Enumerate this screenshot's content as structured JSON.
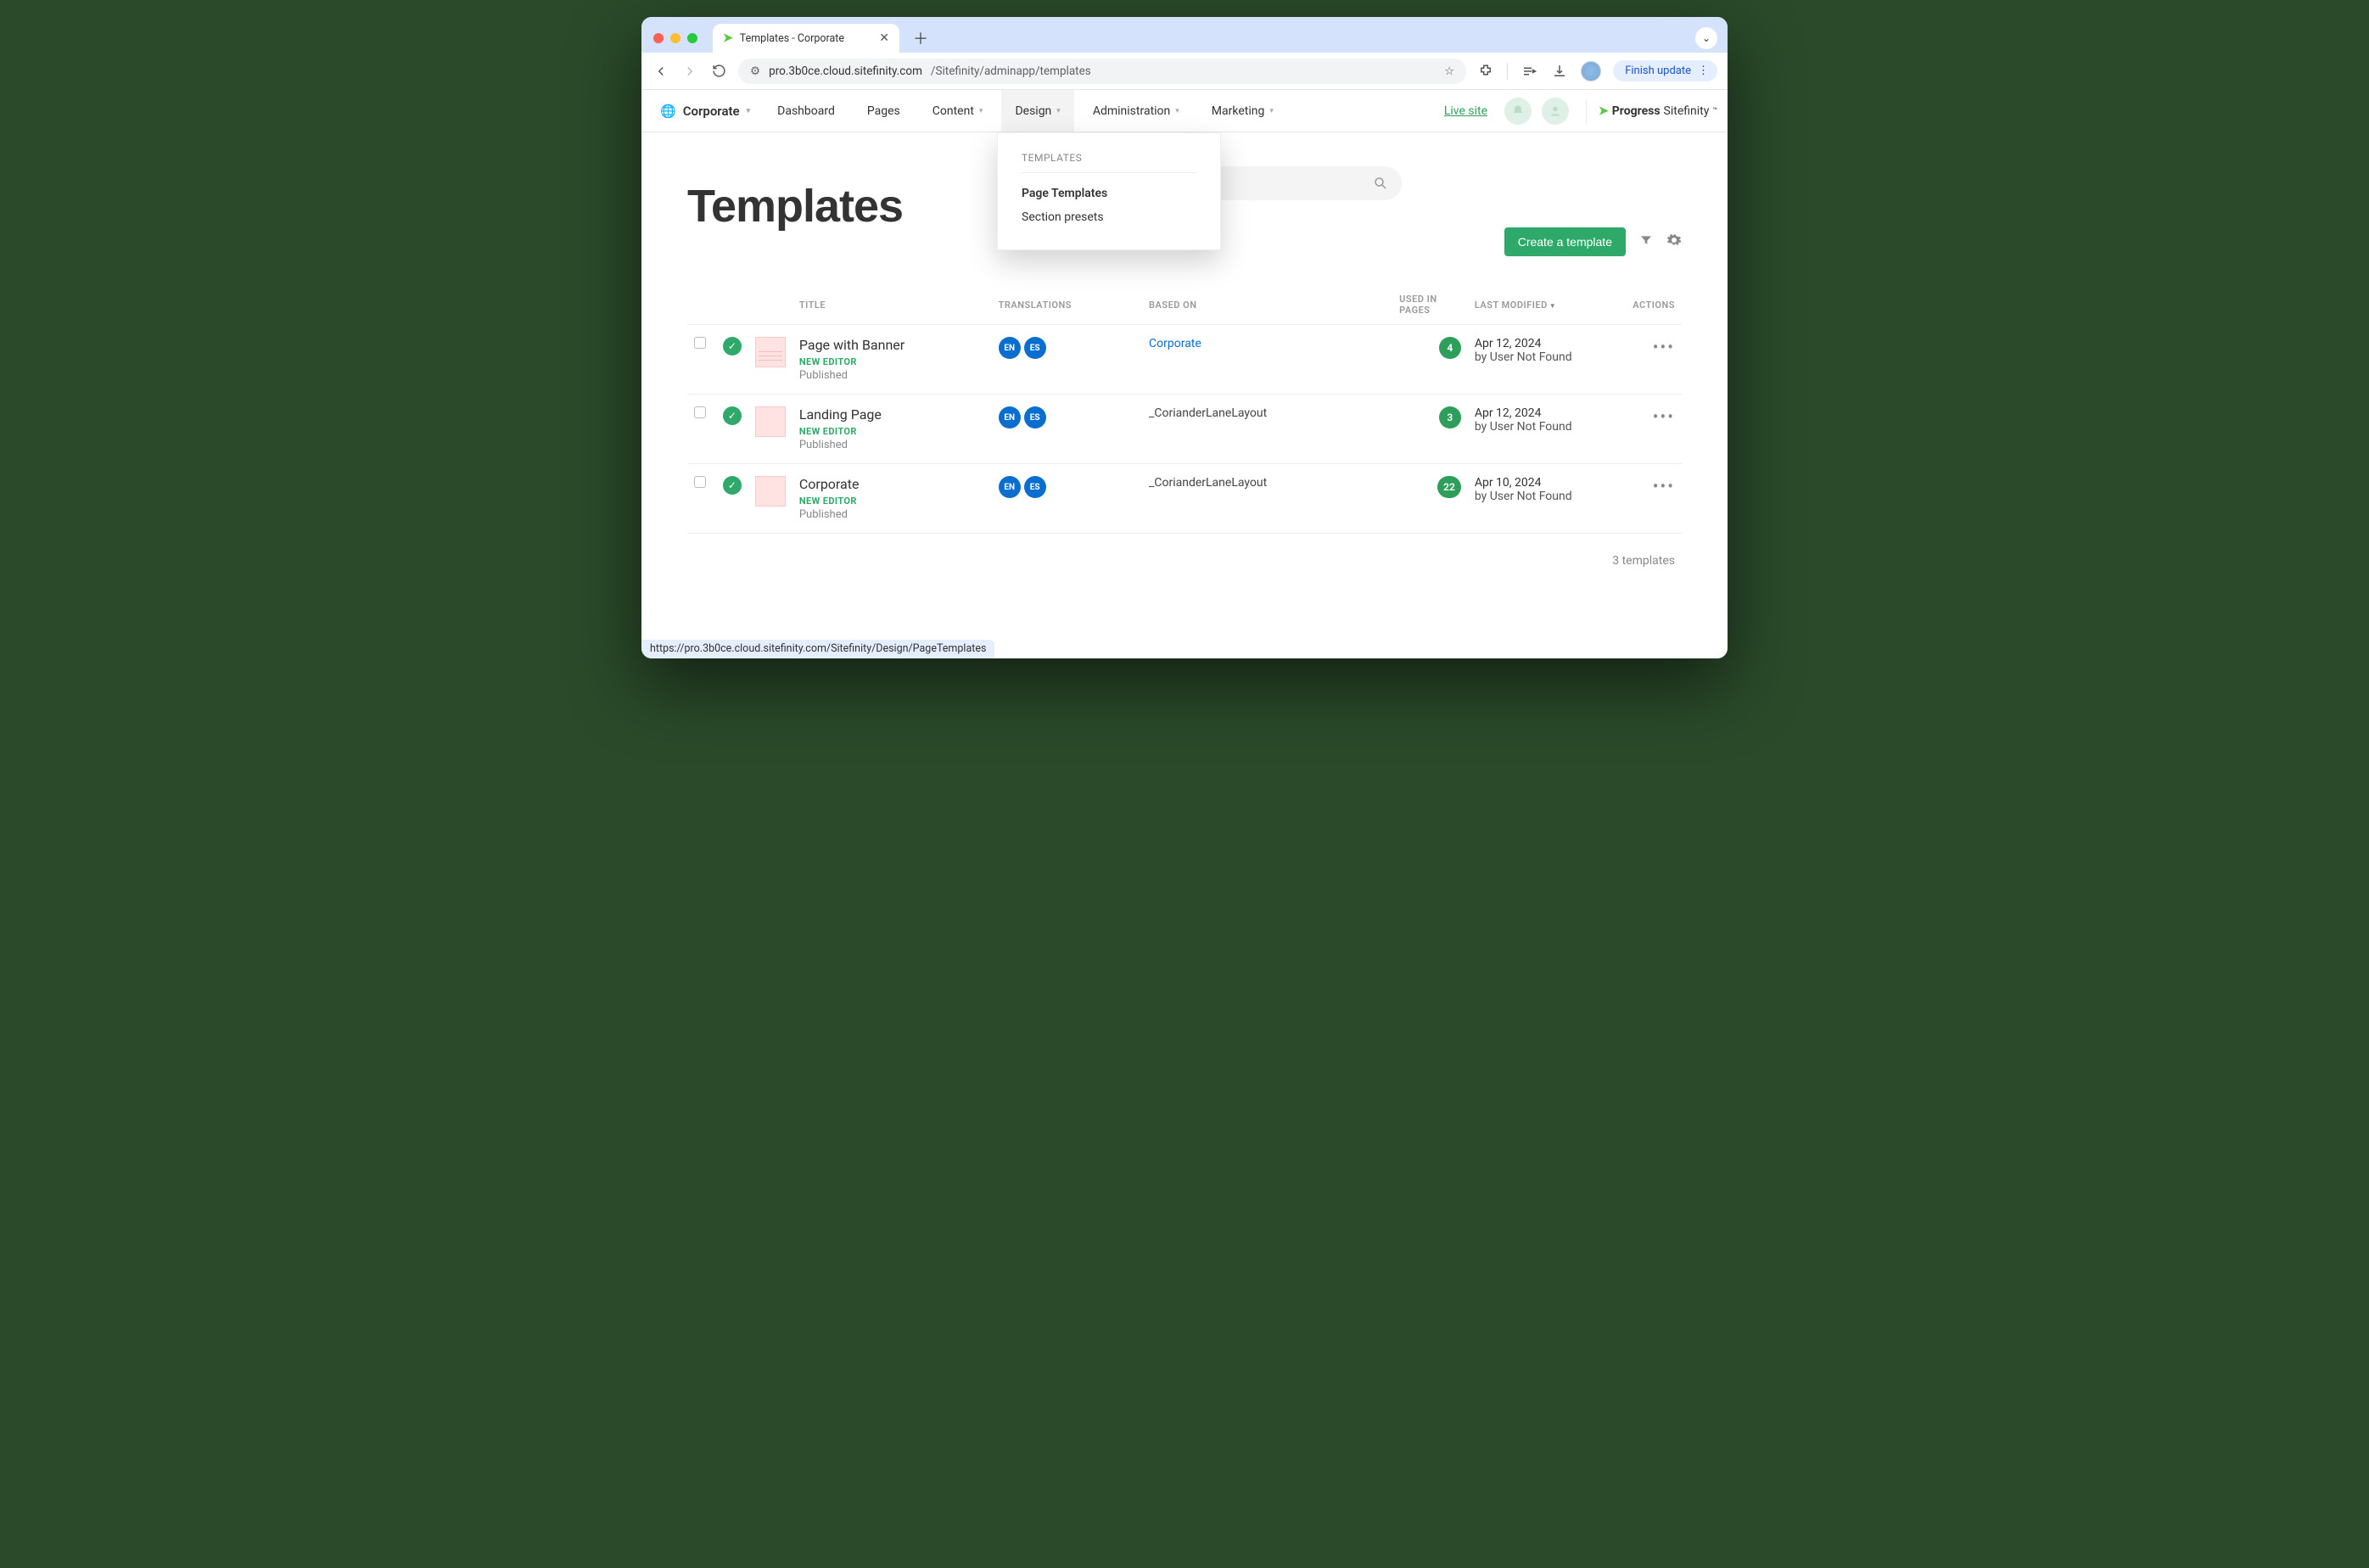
{
  "browser": {
    "tab_title": "Templates - Corporate",
    "url_host": "pro.3b0ce.cloud.sitefinity.com",
    "url_path": "/Sitefinity/adminapp/templates",
    "finish_update": "Finish update"
  },
  "topnav": {
    "site_name": "Corporate",
    "items": {
      "dashboard": "Dashboard",
      "pages": "Pages",
      "content": "Content",
      "design": "Design",
      "administration": "Administration",
      "marketing": "Marketing"
    },
    "live_site": "Live site",
    "brand_a": "Progress",
    "brand_b": "Sitefinity"
  },
  "design_menu": {
    "group": "TEMPLATES",
    "page_templates": "Page Templates",
    "section_presets": "Section presets"
  },
  "page": {
    "title": "Templates",
    "create_btn": "Create a template",
    "columns": {
      "title": "TITLE",
      "translations": "TRANSLATIONS",
      "based_on": "BASED ON",
      "used_in_pages": "USED IN PAGES",
      "last_modified": "LAST MODIFIED",
      "actions": "ACTIONS"
    },
    "footer": "3 templates"
  },
  "rows": [
    {
      "title": "Page with Banner",
      "tag": "NEW EDITOR",
      "status": "Published",
      "langs": [
        "EN",
        "ES"
      ],
      "based_on": "Corporate",
      "based_on_link": true,
      "count": "4",
      "date": "Apr 12, 2024",
      "by": "by User Not Found",
      "thumb_lines": true
    },
    {
      "title": "Landing Page",
      "tag": "NEW EDITOR",
      "status": "Published",
      "langs": [
        "EN",
        "ES"
      ],
      "based_on": "_CorianderLaneLayout",
      "based_on_link": false,
      "count": "3",
      "date": "Apr 12, 2024",
      "by": "by User Not Found",
      "thumb_lines": false
    },
    {
      "title": "Corporate",
      "tag": "NEW EDITOR",
      "status": "Published",
      "langs": [
        "EN",
        "ES"
      ],
      "based_on": "_CorianderLaneLayout",
      "based_on_link": false,
      "count": "22",
      "date": "Apr 10, 2024",
      "by": "by User Not Found",
      "thumb_lines": false
    }
  ],
  "status_url": "https://pro.3b0ce.cloud.sitefinity.com/Sitefinity/Design/PageTemplates"
}
